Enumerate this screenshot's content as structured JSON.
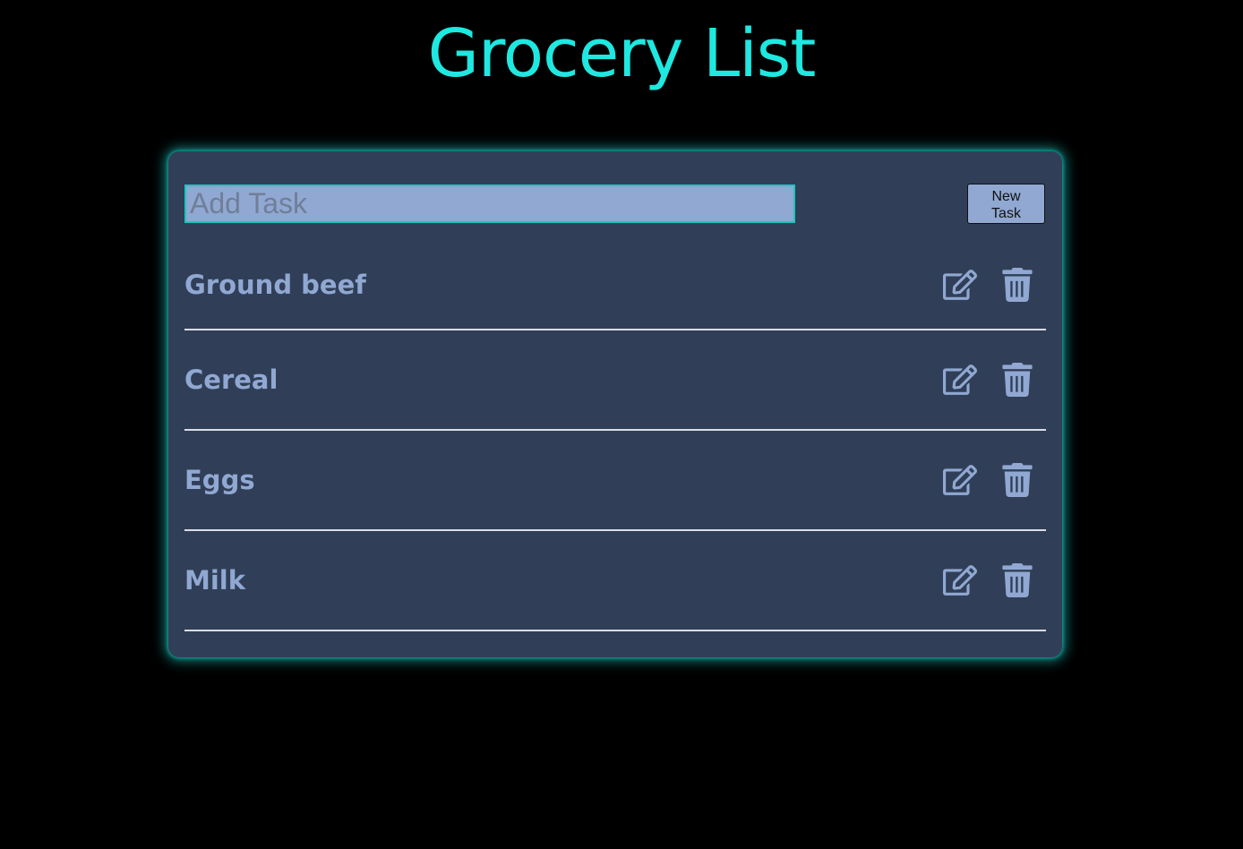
{
  "page": {
    "title": "Grocery List"
  },
  "form": {
    "input_placeholder": "Add Task",
    "input_value": "",
    "new_task_label_line1": "New",
    "new_task_label_line2": "Task"
  },
  "tasks": [
    {
      "label": "Ground beef"
    },
    {
      "label": "Cereal"
    },
    {
      "label": "Eggs"
    },
    {
      "label": "Milk"
    }
  ],
  "icons": {
    "edit": "edit-icon",
    "delete": "trash-icon"
  },
  "colors": {
    "background": "#000000",
    "title": "#1ee8e0",
    "card": "#303f57",
    "accent": "#90a8d2",
    "glow": "#1ee8e0",
    "divider": "#d9dde6"
  }
}
